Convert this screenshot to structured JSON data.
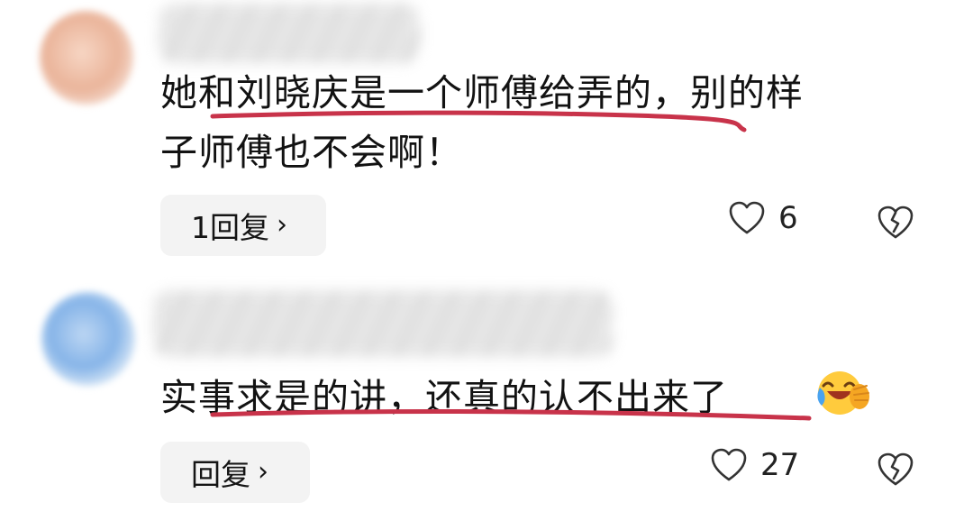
{
  "comments": [
    {
      "text_line1": "她和刘晓庆是一个师傅给弄的，别的样",
      "text_line2": "子师傅也不会啊！",
      "reply_label": "1回复",
      "like_count": "6"
    },
    {
      "text_line1": "实事求是的讲，还真的认不出来了",
      "emoji": "laughing-crying-emoji",
      "reply_label": "回复",
      "like_count": "27"
    }
  ],
  "icons": {
    "like": "heart-outline-icon",
    "dislike": "broken-heart-icon",
    "reply_chevron": "chevron-right-icon"
  },
  "colors": {
    "underline": "#c8334a",
    "reply_bg": "#f3f3f3",
    "icon": "#333333"
  }
}
